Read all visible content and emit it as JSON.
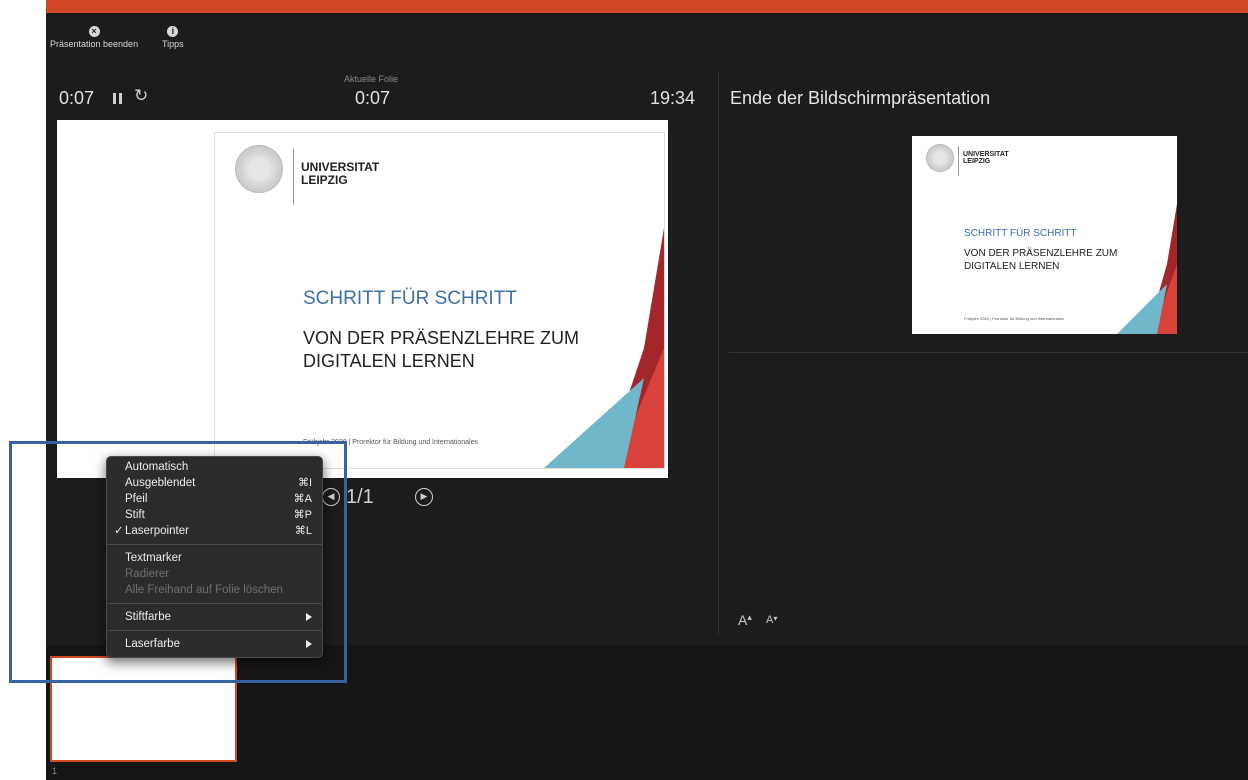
{
  "toolbar": {
    "end_presentation": "Präsentation beenden",
    "tips": "Tipps",
    "end_icon": "close-circle-icon",
    "tips_icon": "info-icon"
  },
  "timers": {
    "elapsed": "0:07",
    "current_slide_label": "Aktuelle Folie",
    "current_slide_time": "0:07",
    "clock": "19:34"
  },
  "slide": {
    "university_line1": "UNIVERSITAT",
    "university_line2": "LEIPZIG",
    "title": "SCHRITT FÜR SCHRITT",
    "subtitle_line1": "VON DER PRÄSENZLEHRE ZUM",
    "subtitle_line2": "DIGITALEN LERNEN",
    "footer_main": "Frühjahr 2020 | Prorektor für Bildung und Internationales",
    "footer_main_visible": "020 | Prorektor für Bildung und Internationales",
    "footer_small": "Frühjahr 2020 | Prorektor für Bildung und Internationales"
  },
  "navigation": {
    "page": "1/1"
  },
  "next": {
    "title": "Ende der Bildschirmpräsentation"
  },
  "font_controls": {
    "increase": "A",
    "decrease": "A"
  },
  "thumbnails": {
    "num": "1"
  },
  "menu": {
    "items": [
      {
        "label": "Automatisch",
        "shortcut": ""
      },
      {
        "label": "Ausgeblendet",
        "shortcut": "⌘I"
      },
      {
        "label": "Pfeil",
        "shortcut": "⌘A"
      },
      {
        "label": "Stift",
        "shortcut": "⌘P"
      },
      {
        "label": "Laserpointer",
        "shortcut": "⌘L"
      }
    ],
    "check": "✓",
    "textmarker": "Textmarker",
    "radierer": "Radierer",
    "clear_all": "Alle Freihand auf Folie löschen",
    "pen_color": "Stiftfarbe",
    "laser_color": "Laserfarbe"
  },
  "colors": {
    "accent": "#d24726",
    "slide_blue": "#3f6ea8",
    "slide_red": "#d9413b",
    "slide_teal": "#6fb7c9",
    "highlight": "#3763a3"
  }
}
